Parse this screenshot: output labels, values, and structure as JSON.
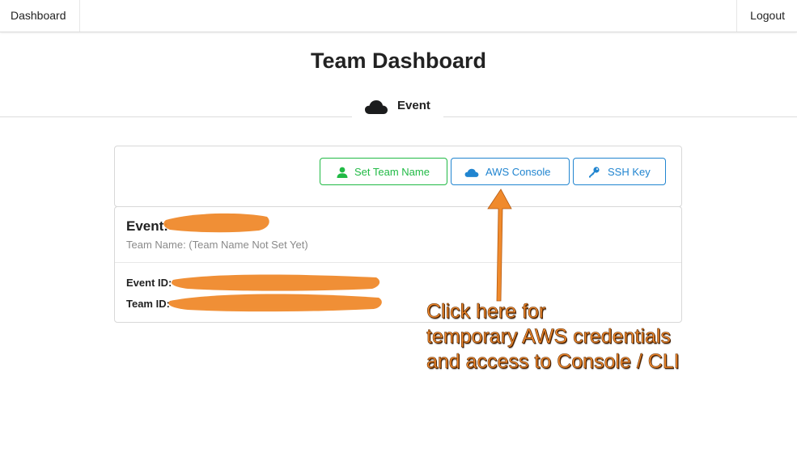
{
  "navbar": {
    "left_link": "Dashboard",
    "right_link": "Logout"
  },
  "page": {
    "title": "Team Dashboard"
  },
  "tabs": [
    {
      "label": "Event",
      "icon": "cloud-icon"
    }
  ],
  "toolbar": {
    "buttons": [
      {
        "label": "Set Team Name",
        "icon": "user-icon",
        "color": "#21ba45"
      },
      {
        "label": "AWS Console",
        "icon": "cloud-icon",
        "color": "#2185d0"
      },
      {
        "label": "SSH Key",
        "icon": "key-icon",
        "color": "#2185d0"
      }
    ]
  },
  "event_card": {
    "title_prefix": "Event:",
    "team_name_text": "Team Name: (Team Name Not Set Yet)",
    "event_id_label": "Event ID:",
    "team_id_label": "Team ID:"
  },
  "annotation": {
    "lines": [
      "Click here for",
      "temporary AWS credentials",
      "and access to Console / CLI"
    ],
    "color": "#f28a2f"
  }
}
